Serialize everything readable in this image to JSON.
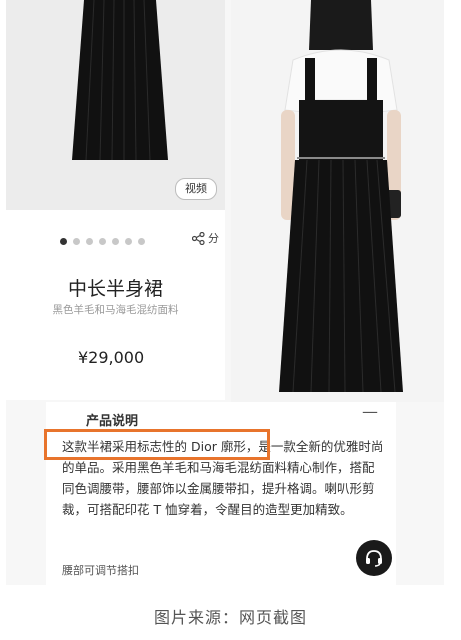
{
  "product": {
    "video_label": "视频",
    "share_label": "分",
    "title": "中长半身裙",
    "subtitle": "黑色羊毛和马海毛混纺面料",
    "price": "¥29,000",
    "carousel": {
      "count": 7,
      "active": 1
    }
  },
  "description": {
    "heading": "产品说明",
    "toggle": "—",
    "text": "这款半裙采用标志性的 Dior 廓形，是一款全新的优雅时尚的单品。采用黑色羊毛和马海毛混纺面料精心制作，搭配同色调腰带，腰部饰以金属腰带扣，提升格调。喇叭形剪裁，可搭配印花 T 恤穿着，令醒目的造型更加精致。",
    "more": "腰部可调节搭扣"
  },
  "caption": "图片来源：网页截图",
  "colors": {
    "highlight": "#e8742c",
    "chat_bg": "#1a1a1a"
  },
  "icons": {
    "share": "share-icon",
    "chat": "headset-icon"
  }
}
